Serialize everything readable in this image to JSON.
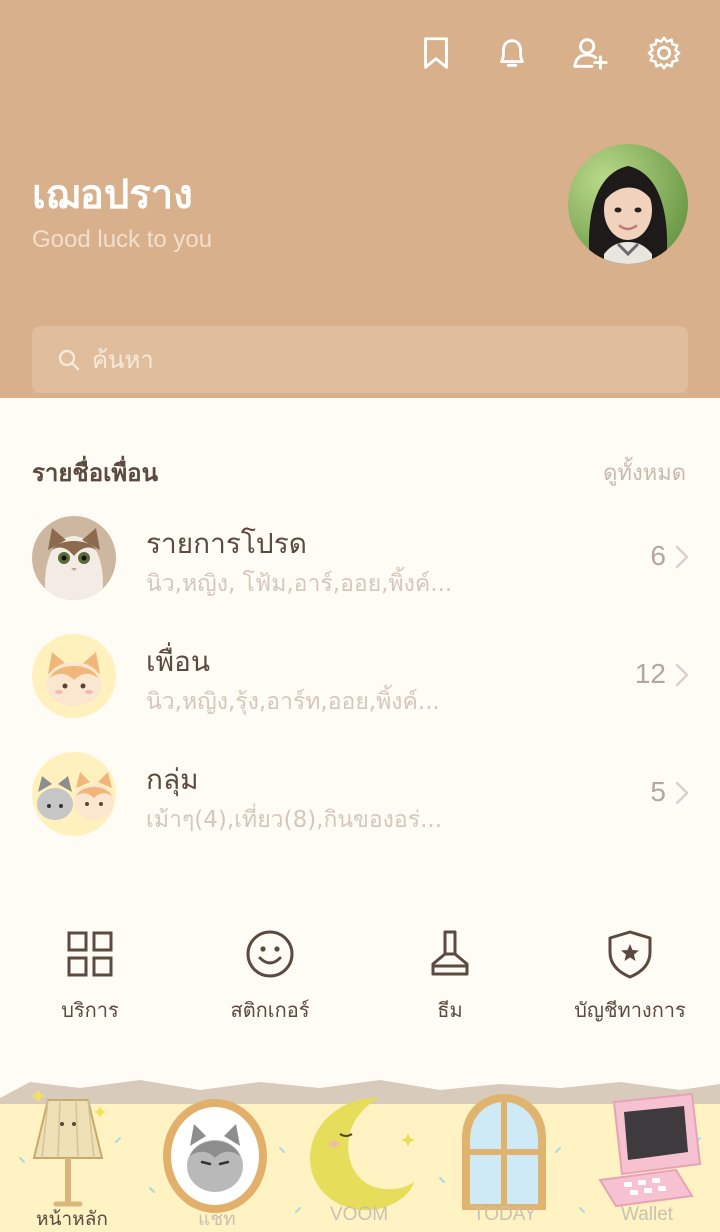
{
  "header": {
    "icons": [
      "bookmark-icon",
      "bell-icon",
      "add-friend-icon",
      "gear-icon"
    ],
    "profile": {
      "name": "เฌอปราง",
      "status": "Good luck to you"
    },
    "search": {
      "placeholder": "ค้นหา"
    }
  },
  "friends": {
    "title": "รายชื่อเพื่อน",
    "see_all": "ดูทั้งหมด",
    "rows": [
      {
        "title": "รายการโปรด",
        "subtitle": "นิว,หญิง, โฟ้ม,อาร์,ออย,พิ้งค์...",
        "count": "6"
      },
      {
        "title": "เพื่อน",
        "subtitle": "นิว,หญิง,รุ้ง,อาร์ท,ออย,พิ้งค์...",
        "count": "12"
      },
      {
        "title": "กลุ่ม",
        "subtitle": "เม้าๆ(4),เที่ยว(8),กินของอร่...",
        "count": "5"
      }
    ]
  },
  "services": [
    {
      "label": "บริการ",
      "icon": "grid-icon"
    },
    {
      "label": "สติกเกอร์",
      "icon": "smiley-icon"
    },
    {
      "label": "ธีม",
      "icon": "brush-icon"
    },
    {
      "label": "บัญชีทางการ",
      "icon": "shield-star-icon"
    }
  ],
  "tabbar": {
    "tabs": [
      {
        "label": "หน้าหลัก",
        "icon": "lamp-icon",
        "active": true
      },
      {
        "label": "แชท",
        "icon": "cat-mirror-icon",
        "active": false
      },
      {
        "label": "VOOM",
        "icon": "moon-icon",
        "active": false
      },
      {
        "label": "TODAY",
        "icon": "window-icon",
        "active": false
      },
      {
        "label": "Wallet",
        "icon": "pink-computer-icon",
        "active": false
      }
    ]
  },
  "colors": {
    "header_bg": "#d8b08c",
    "search_bg": "#e0bd9d",
    "body_bg": "#fefcf4",
    "text_dark": "#5c4a40",
    "text_muted": "#d6c7bd"
  }
}
